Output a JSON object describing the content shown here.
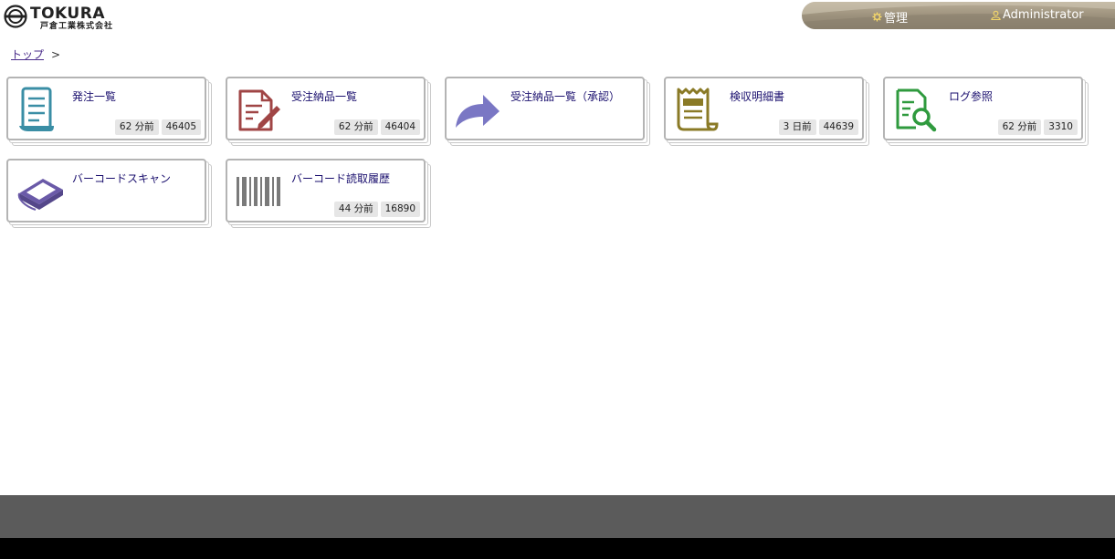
{
  "header": {
    "logo_text": "TOKURA",
    "logo_sub": "戸倉工業株式会社",
    "nav": {
      "admin_label": "管理",
      "user_label": "Administrator"
    }
  },
  "breadcrumb": {
    "home": "トップ",
    "separator": ">"
  },
  "tiles": [
    {
      "title": "発注一覧",
      "time": "62 分前",
      "count": "46405",
      "icon": "document-list-icon"
    },
    {
      "title": "受注納品一覧",
      "time": "62 分前",
      "count": "46404",
      "icon": "document-edit-icon"
    },
    {
      "title": "受注納品一覧（承認）",
      "time": "",
      "count": "",
      "icon": "share-arrow-icon"
    },
    {
      "title": "検収明細書",
      "time": "3 日前",
      "count": "44639",
      "icon": "receipt-icon"
    },
    {
      "title": "ログ参照",
      "time": "62 分前",
      "count": "3310",
      "icon": "document-search-icon"
    },
    {
      "title": "バーコードスキャン",
      "time": "",
      "count": "",
      "icon": "scanner-icon"
    },
    {
      "title": "バーコード読取履歴",
      "time": "44 分前",
      "count": "16890",
      "icon": "barcode-icon"
    }
  ],
  "colors": {
    "doc_teal": "#3a8ea5",
    "doc_red": "#a04545",
    "arrow_purple": "#7a77c4",
    "receipt_olive": "#8a7a26",
    "search_green": "#2f9a3e",
    "scanner_purple": "#6a5aa8",
    "barcode_gray": "#7a7a7a",
    "footer_gray": "#5b5b5b"
  }
}
